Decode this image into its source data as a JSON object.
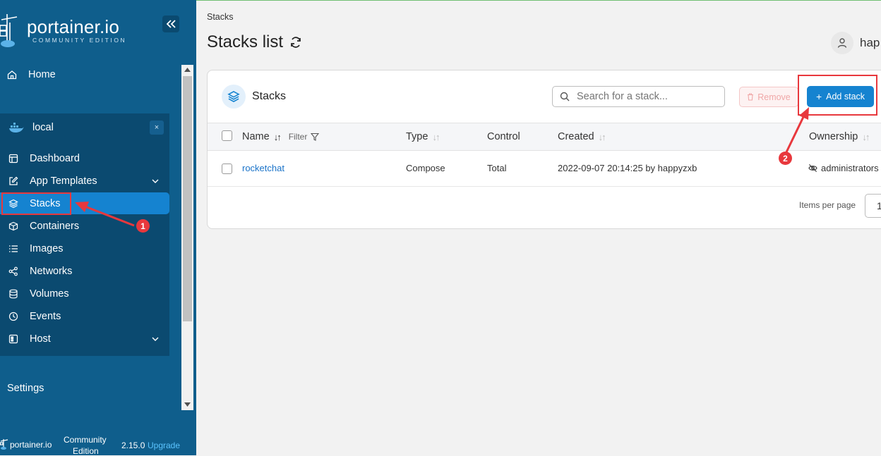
{
  "sidebar": {
    "logo_main": "portainer.io",
    "logo_sub": "COMMUNITY EDITION",
    "home_label": "Home",
    "environment_name": "local",
    "environment_close": "×",
    "items": [
      {
        "label": "Dashboard",
        "icon": "dashboard-icon"
      },
      {
        "label": "App Templates",
        "icon": "edit-icon",
        "expandable": true
      },
      {
        "label": "Stacks",
        "icon": "layers-icon",
        "active": true
      },
      {
        "label": "Containers",
        "icon": "box-icon"
      },
      {
        "label": "Images",
        "icon": "list-icon"
      },
      {
        "label": "Networks",
        "icon": "share-icon"
      },
      {
        "label": "Volumes",
        "icon": "database-icon"
      },
      {
        "label": "Events",
        "icon": "clock-icon"
      },
      {
        "label": "Host",
        "icon": "server-icon",
        "expandable": true
      }
    ],
    "settings_label": "Settings",
    "footer": {
      "brand": "portainer.io",
      "edition_line1": "Community",
      "edition_line2": "Edition",
      "version": "2.15.0",
      "upgrade_label": "Upgrade"
    }
  },
  "header": {
    "breadcrumb": "Stacks",
    "title": "Stacks list",
    "user_name": "hap"
  },
  "stacks_panel": {
    "title": "Stacks",
    "search_placeholder": "Search for a stack...",
    "remove_label": "Remove",
    "add_label": "Add stack",
    "columns": {
      "name": "Name",
      "filter": "Filter",
      "type": "Type",
      "control": "Control",
      "created": "Created",
      "ownership": "Ownership"
    },
    "rows": [
      {
        "name": "rocketchat",
        "type": "Compose",
        "control": "Total",
        "created": "2022-09-07 20:14:25 by happyzxb",
        "ownership": "administrators"
      }
    ],
    "items_per_page_label": "Items per page",
    "items_per_page_value": "1"
  },
  "annotations": {
    "badge_1": "1",
    "badge_2": "2",
    "color": "#e8383d"
  },
  "colors": {
    "sidebar_bg": "#0f5e8c",
    "env_bg": "#0b4a70",
    "accent": "#1583d0"
  }
}
